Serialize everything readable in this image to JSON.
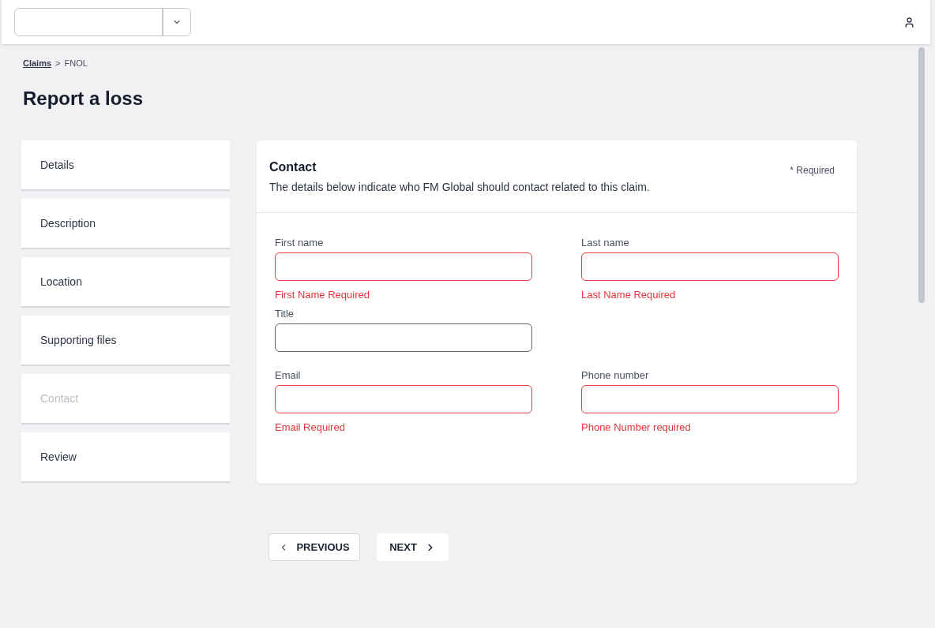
{
  "breadcrumb": {
    "items": [
      {
        "label": "Claims",
        "link": true
      },
      {
        "label": "FNOL",
        "link": false
      }
    ],
    "separator": ">"
  },
  "page_title": "Report a loss",
  "steps": [
    {
      "label": "Details",
      "selected": false
    },
    {
      "label": "Description",
      "selected": false
    },
    {
      "label": "Location",
      "selected": false
    },
    {
      "label": "Supporting files",
      "selected": false
    },
    {
      "label": "Contact",
      "selected": true
    },
    {
      "label": "Review",
      "selected": false
    }
  ],
  "form": {
    "title": "Contact",
    "description": "The details below indicate who FM Global should contact related to this claim.",
    "required_note": "* Required",
    "rows": [
      [
        {
          "label": "First name",
          "invalid": true,
          "error": "First Name Required"
        },
        {
          "label": "Last name",
          "invalid": true,
          "error": "Last Name Required"
        }
      ],
      [
        {
          "label": "Title",
          "invalid": false
        }
      ],
      [
        {
          "label": "Email",
          "invalid": true,
          "error": "Email Required"
        },
        {
          "label": "Phone number",
          "invalid": true,
          "error": "Phone Number required"
        }
      ]
    ]
  },
  "buttons": [
    {
      "label": "PREVIOUS",
      "kind": "previous"
    },
    {
      "label": "NEXT",
      "kind": "next"
    }
  ]
}
